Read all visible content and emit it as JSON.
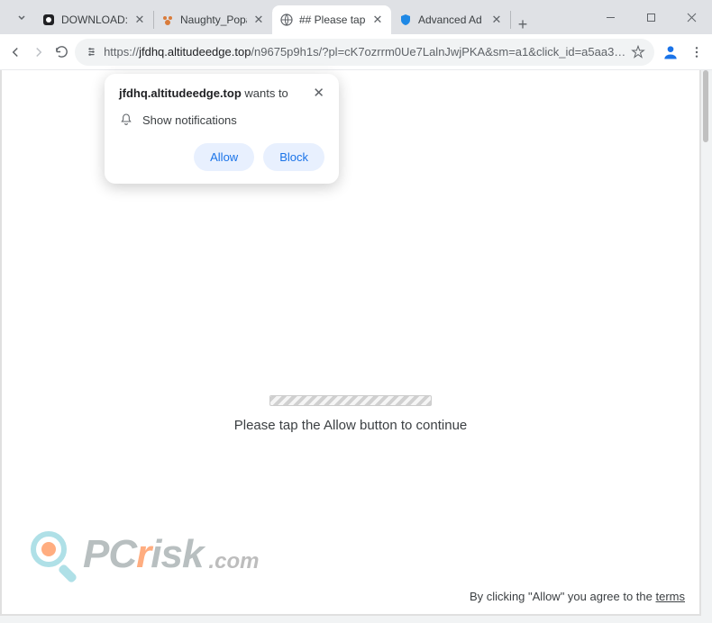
{
  "tabs": [
    {
      "label": "DOWNLOAD: Red",
      "favicon": "record"
    },
    {
      "label": "Naughty_Popa's F",
      "favicon": "paw"
    },
    {
      "label": "## Please tap the",
      "favicon": "globe",
      "active": true
    },
    {
      "label": "Advanced Ad Blo",
      "favicon": "shield"
    }
  ],
  "addr": {
    "scheme": "https://",
    "host": "jfdhq.altitudeedge.top",
    "path": "/n9675p9h1s/?pl=cK7ozrrm0Ue7LalnJwjPKA&sm=a1&click_id=a5aa3…"
  },
  "perm": {
    "domain": "jfdhq.altitudeedge.top",
    "wants": " wants to",
    "body": "Show notifications",
    "allow": "Allow",
    "block": "Block"
  },
  "page": {
    "message": "Please tap the Allow button to continue"
  },
  "watermark": {
    "pc": "PC",
    "r": "r",
    "isk": "isk",
    "com": ".com"
  },
  "footer": {
    "prefix": "By clicking \"Allow\" you agree to the ",
    "terms": "terms"
  }
}
